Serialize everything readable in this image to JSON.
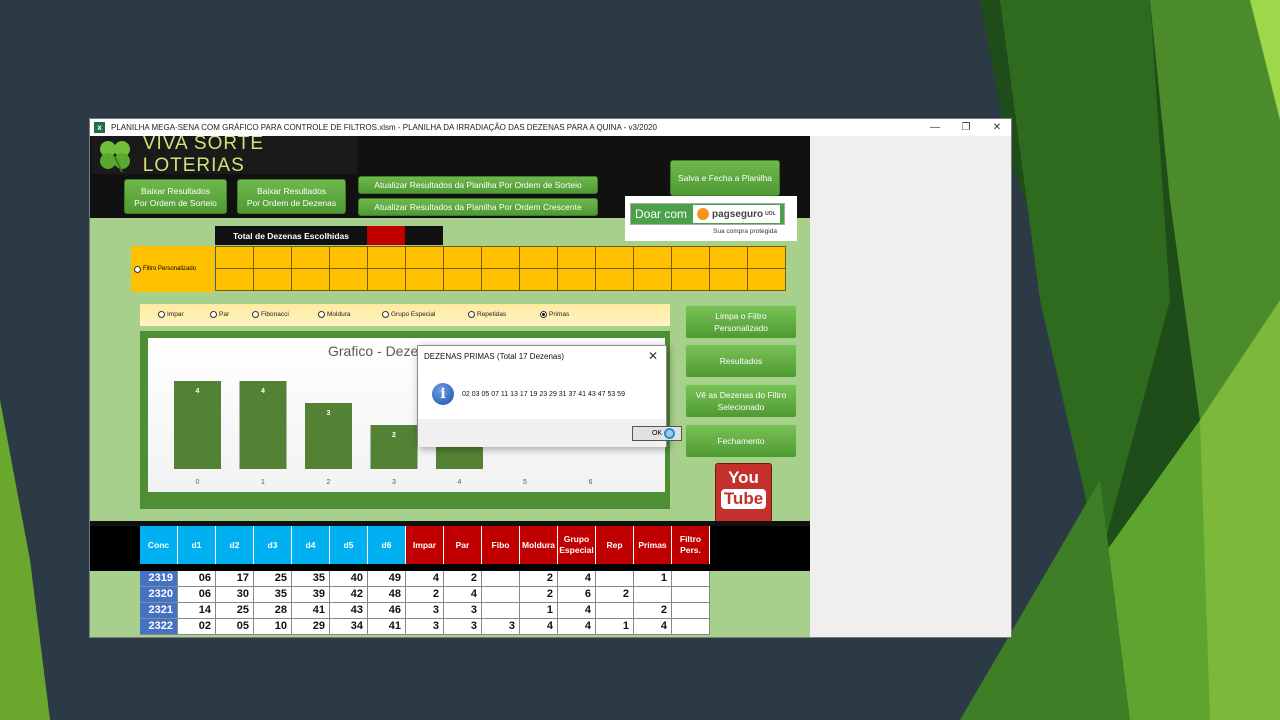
{
  "window": {
    "title": "PLANILHA MEGA-SENA COM GRÁFICO PARA CONTROLE DE FILTROS.xlsm - PLANILHA DA IRRADIAÇÃO DAS DEZENAS PARA A QUINA - v3/2020",
    "minimize": "—",
    "restore": "❐",
    "close": "✕"
  },
  "header": {
    "logo_text": "VIVA SORTE LOTERIAS",
    "btn_baixar_sorteio": "Baixar Resultados\nPor Ordem de Sorteio",
    "btn_baixar_dezenas": "Baixar Resultados\nPor Ordem de Dezenas",
    "btn_atualizar_sorteio": "Atualizar Resultados  da Planilha Por Ordem de Sorteio",
    "btn_atualizar_crescente": "Atualizar Resultados  da Planilha Por Ordem Crescente",
    "btn_salva_fecha": "Salva e Fecha a Planilha"
  },
  "donate": {
    "label": "Doar com",
    "brand": "pagseguro",
    "brand_sub": "UOL",
    "tagline": "Sua compra protegida"
  },
  "total_label": "Total de Dezenas Escolhidas",
  "filtro_personalizado": "Filtro Personalizado",
  "filters": [
    {
      "label": "Impar",
      "selected": false
    },
    {
      "label": "Par",
      "selected": false
    },
    {
      "label": "Fibonacci",
      "selected": false
    },
    {
      "label": "Moldura",
      "selected": false
    },
    {
      "label": "Grupo Especial",
      "selected": false
    },
    {
      "label": "Repetidas",
      "selected": false
    },
    {
      "label": "Primas",
      "selected": true
    }
  ],
  "side_buttons": {
    "limpa": "Limpa o Filtro\nPersonalizado",
    "resultados": "Resultados",
    "ve_dezenas": "Vê as Dezenas do Filtro\nSelecionado",
    "fechamento": "Fechamento",
    "youtube_you": "You",
    "youtube_tube": "Tube"
  },
  "chart_data": {
    "type": "bar",
    "title": "Grafico - Deze",
    "categories": [
      "0",
      "1",
      "2",
      "3",
      "4",
      "5",
      "6"
    ],
    "values": [
      4,
      4,
      3,
      2,
      2,
      0,
      0
    ],
    "data_labels": [
      "4",
      "4",
      "3",
      "2",
      "",
      "",
      ""
    ],
    "ylim": [
      0,
      5
    ],
    "bar_color": "#548235"
  },
  "table": {
    "headers": [
      "Conc",
      "d1",
      "d2",
      "d3",
      "d4",
      "d5",
      "d6",
      "Impar",
      "Par",
      "Fibo",
      "Moldura",
      "Grupo Especial",
      "Rep",
      "Primas",
      "Filtro Pers."
    ],
    "rows": [
      [
        "2319",
        "06",
        "17",
        "25",
        "35",
        "40",
        "49",
        "4",
        "2",
        "",
        "2",
        "4",
        "",
        "1",
        ""
      ],
      [
        "2320",
        "06",
        "30",
        "35",
        "39",
        "42",
        "48",
        "2",
        "4",
        "",
        "2",
        "6",
        "2",
        "",
        ""
      ],
      [
        "2321",
        "14",
        "25",
        "28",
        "41",
        "43",
        "46",
        "3",
        "3",
        "",
        "1",
        "4",
        "",
        "2",
        ""
      ],
      [
        "2322",
        "02",
        "05",
        "10",
        "29",
        "34",
        "41",
        "3",
        "3",
        "3",
        "4",
        "4",
        "1",
        "4",
        ""
      ]
    ]
  },
  "dialog": {
    "title": "DEZENAS PRIMAS (Total 17 Dezenas)",
    "close": "✕",
    "icon": "i",
    "message": "02   03   05   07   11   13   17   19   23   29   31   37   41   43   47   53   59",
    "ok": "OK"
  }
}
